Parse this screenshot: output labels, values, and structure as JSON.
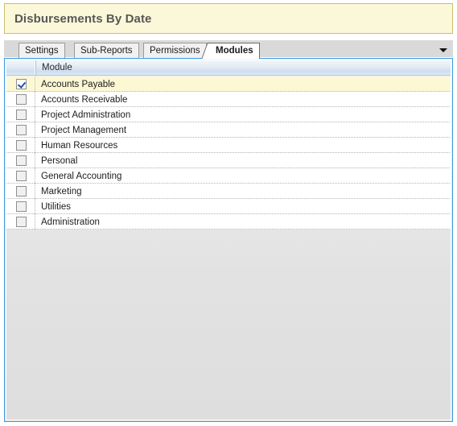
{
  "window": {
    "title": "Disbursements By Date"
  },
  "tabs": {
    "items": [
      {
        "label": "Settings",
        "active": false
      },
      {
        "label": "Sub-Reports",
        "active": false
      },
      {
        "label": "Permissions",
        "active": false
      },
      {
        "label": "Modules",
        "active": true
      }
    ],
    "overflow_icon": "chevron-down-icon"
  },
  "grid": {
    "columns": [
      {
        "key": "checkbox",
        "label": ""
      },
      {
        "key": "module",
        "label": "Module"
      }
    ],
    "rows": [
      {
        "module": "Accounts Payable",
        "checked": true,
        "selected": true
      },
      {
        "module": "Accounts Receivable",
        "checked": false,
        "selected": false
      },
      {
        "module": "Project Administration",
        "checked": false,
        "selected": false
      },
      {
        "module": "Project Management",
        "checked": false,
        "selected": false
      },
      {
        "module": "Human Resources",
        "checked": false,
        "selected": false
      },
      {
        "module": "Personal",
        "checked": false,
        "selected": false
      },
      {
        "module": "General Accounting",
        "checked": false,
        "selected": false
      },
      {
        "module": "Marketing",
        "checked": false,
        "selected": false
      },
      {
        "module": "Utilities",
        "checked": false,
        "selected": false
      },
      {
        "module": "Administration",
        "checked": false,
        "selected": false
      }
    ]
  },
  "colors": {
    "banner_background": "#fbf8d9",
    "banner_border": "#c9bd6d",
    "banner_text": "#575757",
    "panel_border": "#3c9ae8",
    "row_selected": "#fcf8d4",
    "checkbox_tick": "#1b55a8",
    "header_gradient_top": "#f2f6fb",
    "header_gradient_bottom": "#cfddee"
  }
}
